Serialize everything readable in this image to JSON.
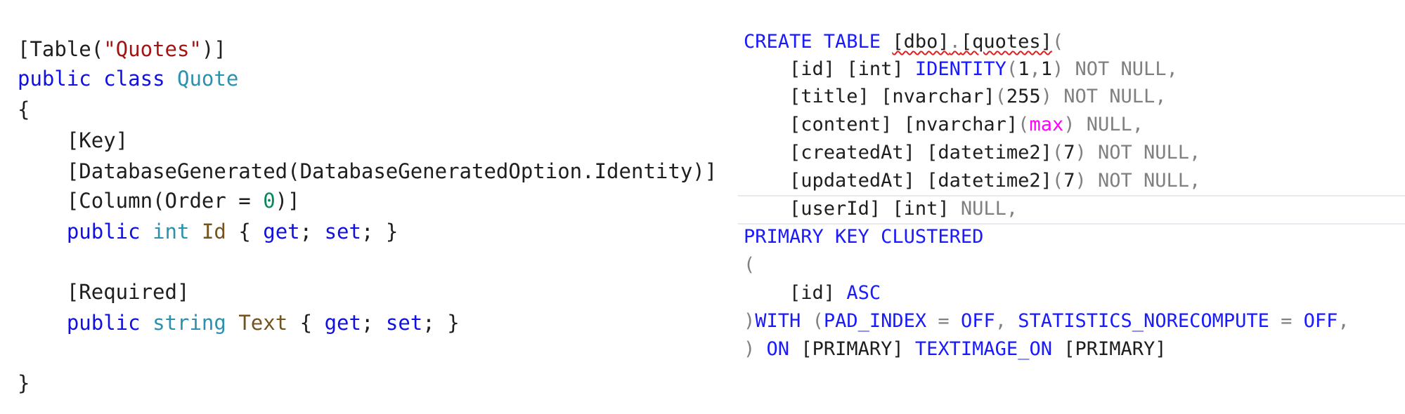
{
  "csharp": {
    "lines": [
      {
        "attr_open": "[Table(",
        "table_name": "\"Quotes\"",
        "attr_close": ")]"
      },
      {
        "kw_public": "public",
        "kw_class": "class",
        "class_name": "Quote"
      },
      {
        "brace": "{"
      },
      {
        "attr": "[Key]"
      },
      {
        "attr": "[DatabaseGenerated(DatabaseGeneratedOption.Identity)]"
      },
      {
        "attr_open": "[Column(Order = ",
        "order_value": "0",
        "attr_close": ")]"
      },
      {
        "kw_public": "public",
        "type": "int",
        "name": "Id",
        "brace_open": "{",
        "get": "get",
        "set": "set",
        "brace_close": "}"
      },
      {
        "attr": "[Required]"
      },
      {
        "kw_public": "public",
        "type": "string",
        "name": "Text",
        "brace_open": "{",
        "get": "get",
        "set": "set",
        "brace_close": "}"
      },
      {
        "brace": "}"
      }
    ]
  },
  "sql": {
    "line1": {
      "create": "CREATE TABLE",
      "schema": "[dbo]",
      "dot": ".",
      "table": "[quotes]",
      "paren": "("
    },
    "line2": {
      "col": "[id]",
      "type": "[int]",
      "identity": "IDENTITY",
      "args_open": "(",
      "seed": "1",
      "comma": ",",
      "inc": "1",
      "args_close": ")",
      "notnull": "NOT NULL",
      "trail": ","
    },
    "line3": {
      "col": "[title]",
      "type": "[nvarchar]",
      "args_open": "(",
      "size": "255",
      "args_close": ")",
      "notnull": "NOT NULL",
      "trail": ","
    },
    "line4": {
      "col": "[content]",
      "type": "[nvarchar]",
      "args_open": "(",
      "size": "max",
      "args_close": ")",
      "null": "NULL",
      "trail": ","
    },
    "line5": {
      "col": "[createdAt]",
      "type": "[datetime2]",
      "args_open": "(",
      "size": "7",
      "args_close": ")",
      "notnull": "NOT NULL",
      "trail": ","
    },
    "line6": {
      "col": "[updatedAt]",
      "type": "[datetime2]",
      "args_open": "(",
      "size": "7",
      "args_close": ")",
      "notnull": "NOT NULL",
      "trail": ","
    },
    "line7": {
      "col": "[userId]",
      "type": "[int]",
      "null": "NULL",
      "trail": ","
    },
    "line8": {
      "pk": "PRIMARY KEY CLUSTERED"
    },
    "line9": {
      "paren": "("
    },
    "line10": {
      "col": "[id]",
      "asc": "ASC"
    },
    "line11": {
      "paren": ")",
      "with": "WITH",
      "open": "(",
      "pad_index": "PAD_INDEX",
      "eq1": "=",
      "off1": "OFF",
      "comma1": ",",
      "stats": "STATISTICS_NORECOMPUTE",
      "eq2": "=",
      "off2": "OFF",
      "comma2": ","
    },
    "line12": {
      "paren": ")",
      "on": "ON",
      "primary1": "[PRIMARY]",
      "textimage": "TEXTIMAGE_ON",
      "primary2": "[PRIMARY]"
    }
  },
  "colors": {
    "keyword": "#0000ff",
    "type": "#2b91af",
    "string": "#a31515",
    "number": "#09885a",
    "identifier": "#74531f",
    "sql_keyword": "#1a1aff",
    "sql_gray": "#808080",
    "sql_function": "#ff00ff"
  }
}
